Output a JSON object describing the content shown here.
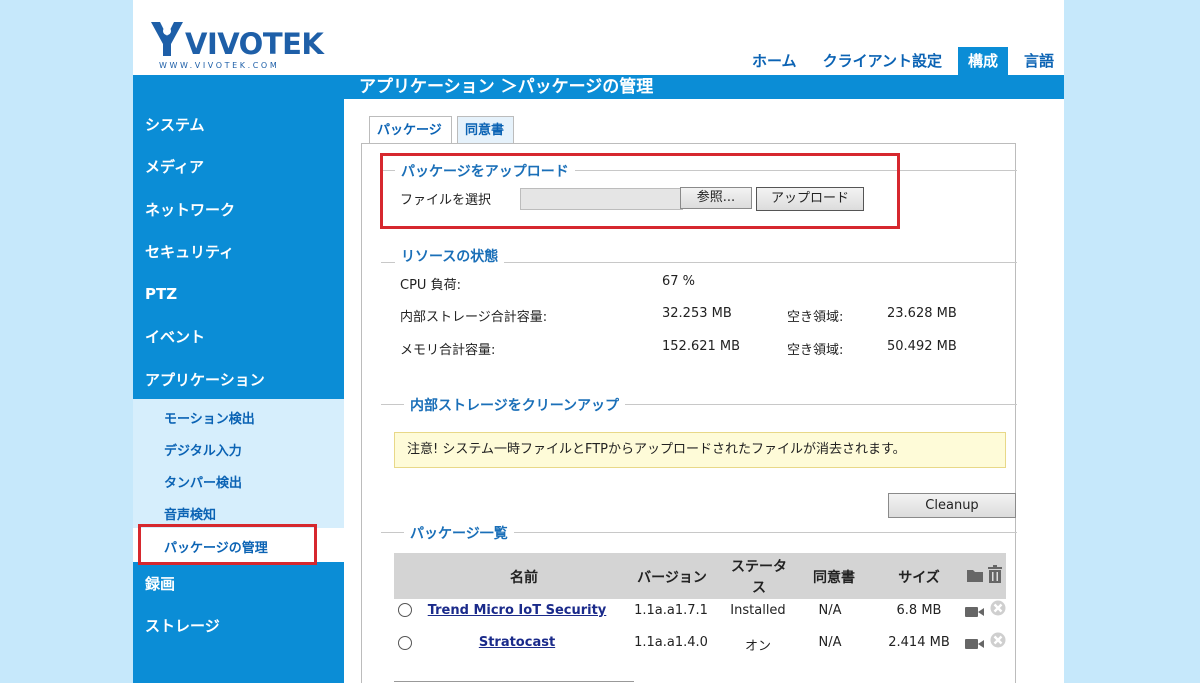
{
  "brand": {
    "logo_text": "VIVOTEK",
    "url_text": "WWW.VIVOTEK.COM"
  },
  "top_nav": [
    "ホーム",
    "クライアント設定",
    "構成",
    "言語"
  ],
  "page_title": "アプリケーション ＞パッケージの管理",
  "sidebar": {
    "items": [
      "システム",
      "メディア",
      "ネットワーク",
      "セキュリティ",
      "PTZ",
      "イベント",
      "アプリケーション",
      "録画",
      "ストレージ"
    ],
    "submenu": [
      "モーション検出",
      "デジタル入力",
      "タンパー検出",
      "音声検知"
    ],
    "active_sub": "パッケージの管理"
  },
  "tabs": [
    "パッケージ",
    "同意書"
  ],
  "upload": {
    "title": "パッケージをアップロード",
    "file_label": "ファイルを選択",
    "browse": "参照...",
    "upload_button": "アップロード"
  },
  "resources": {
    "title": "リソースの状態",
    "cpu_label": "CPU 負荷:",
    "cpu_value": "67 %",
    "storage_label": "内部ストレージ合計容量:",
    "storage_value": "32.253 MB",
    "storage_free_label": "空き領域:",
    "storage_free_value": "23.628 MB",
    "memory_label": "メモリ合計容量:",
    "memory_value": "152.621 MB",
    "memory_free_label": "空き領域:",
    "memory_free_value": "50.492 MB"
  },
  "cleanup": {
    "title": "内部ストレージをクリーンアップ",
    "notice": "注意! システム一時ファイルとFTPからアップロードされたファイルが消去されます。",
    "button": "Cleanup"
  },
  "packages": {
    "title": "パッケージ一覧",
    "columns": {
      "name": "名前",
      "version": "バージョン",
      "status_line1": "ステータ",
      "status_line2": "ス",
      "license": "同意書",
      "size": "サイズ"
    },
    "rows": [
      {
        "name": "Trend Micro IoT Security",
        "version": "1.1a.a1.7.1",
        "status": "Installed",
        "license": "N/A",
        "size": "6.8 MB"
      },
      {
        "name": "Stratocast",
        "version": "1.1a.a1.4.0",
        "status": "オン",
        "license": "N/A",
        "size": "2.414 MB"
      }
    ]
  },
  "colors": {
    "brand_blue": "#0b8dd6",
    "highlight_red": "#d6282e",
    "page_bg": "#c6e8fb"
  }
}
